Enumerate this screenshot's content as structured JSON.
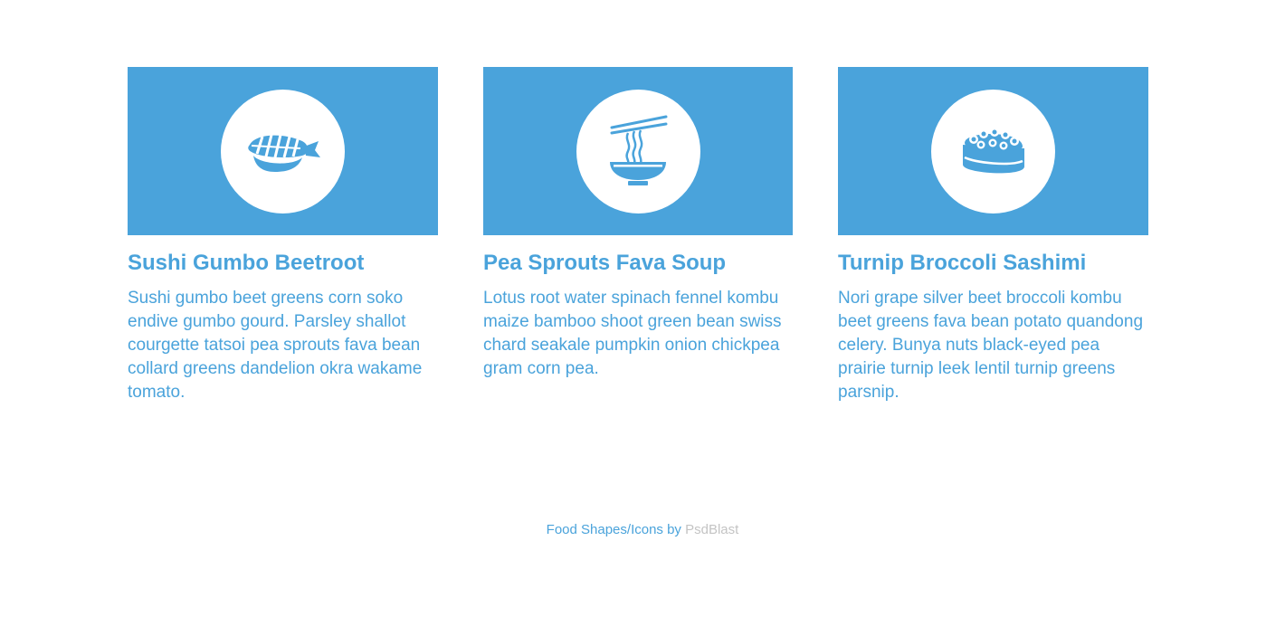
{
  "cards": [
    {
      "icon": "sushi-shrimp-icon",
      "title": "Sushi Gumbo Beetroot",
      "text": "Sushi gumbo beet greens corn soko endive gumbo gourd. Parsley shallot courgette tatsoi pea sprouts fava bean collard greens dandelion okra wakame tomato."
    },
    {
      "icon": "noodle-bowl-icon",
      "title": "Pea Sprouts Fava Soup",
      "text": "Lotus root water spinach fennel kombu maize bamboo shoot green bean swiss chard seakale pumpkin onion chickpea gram corn pea."
    },
    {
      "icon": "sushi-roe-icon",
      "title": "Turnip Broccoli Sashimi",
      "text": "Nori grape silver beet broccoli kombu beet greens fava bean potato quandong celery. Bunya nuts black-eyed pea prairie turnip leek lentil turnip greens parsnip."
    }
  ],
  "footer": {
    "prefix": "Food Shapes/Icons by",
    "link": "PsdBlast"
  },
  "colors": {
    "accent": "#4aa3db",
    "background": "#ffffff",
    "link_muted": "#c4c4c4"
  }
}
